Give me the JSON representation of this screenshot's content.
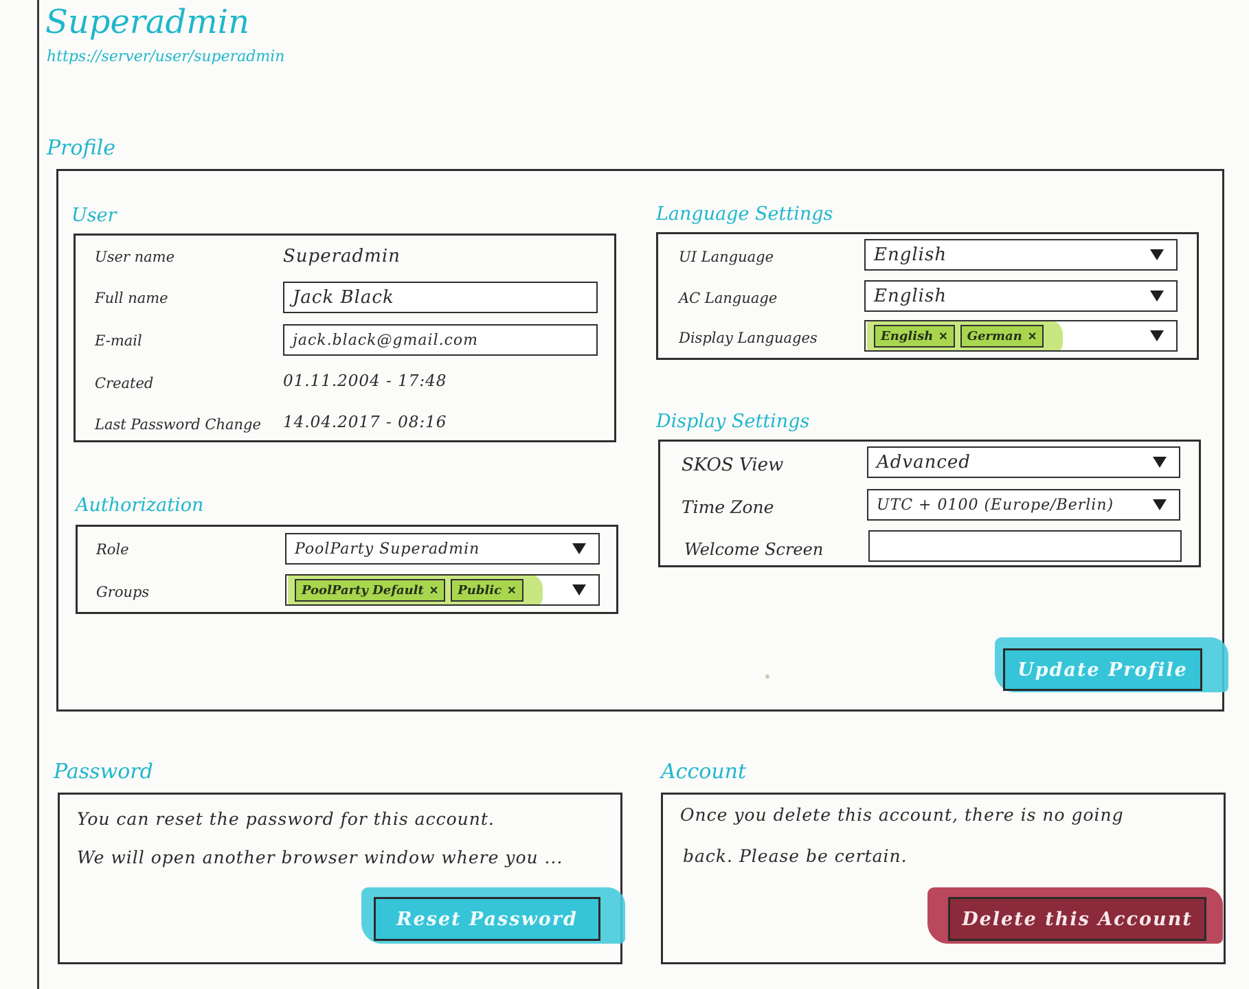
{
  "header": {
    "title": "Superadmin",
    "url": "https://server/user/superadmin"
  },
  "profile": {
    "title": "Profile",
    "user": {
      "title": "User",
      "username_label": "User name",
      "username_value": "Superadmin",
      "fullname_label": "Full name",
      "fullname_value": "Jack Black",
      "email_label": "E-mail",
      "email_value": "jack.black@gmail.com",
      "created_label": "Created",
      "created_value": "01.11.2004 - 17:48",
      "last_pw_label": "Last Password Change",
      "last_pw_value": "14.04.2017 - 08:16"
    },
    "authorization": {
      "title": "Authorization",
      "role_label": "Role",
      "role_value": "PoolParty Superadmin",
      "groups_label": "Groups",
      "groups": [
        "PoolParty Default",
        "Public"
      ]
    },
    "language_settings": {
      "title": "Language Settings",
      "ui_label": "UI Language",
      "ui_value": "English",
      "ac_label": "AC Language",
      "ac_value": "English",
      "display_label": "Display Languages",
      "display_values": [
        "English",
        "German"
      ]
    },
    "display_settings": {
      "title": "Display Settings",
      "skos_label": "SKOS View",
      "skos_value": "Advanced",
      "timezone_label": "Time Zone",
      "timezone_value": "UTC + 0100 (Europe/Berlin)",
      "welcome_label": "Welcome Screen",
      "welcome_value": ""
    },
    "update_button": "Update Profile"
  },
  "password": {
    "title": "Password",
    "line1": "You can reset the password for this account.",
    "line2": "We will open another browser window where you ...",
    "reset_button": "Reset Password"
  },
  "account": {
    "title": "Account",
    "line1": "Once you delete this account, there is no going",
    "line2": "back. Please be certain.",
    "delete_button": "Delete this Account"
  },
  "colors": {
    "accent": "#1fb7cc",
    "chip": "#a9d64f",
    "danger": "#8a2a3a"
  }
}
